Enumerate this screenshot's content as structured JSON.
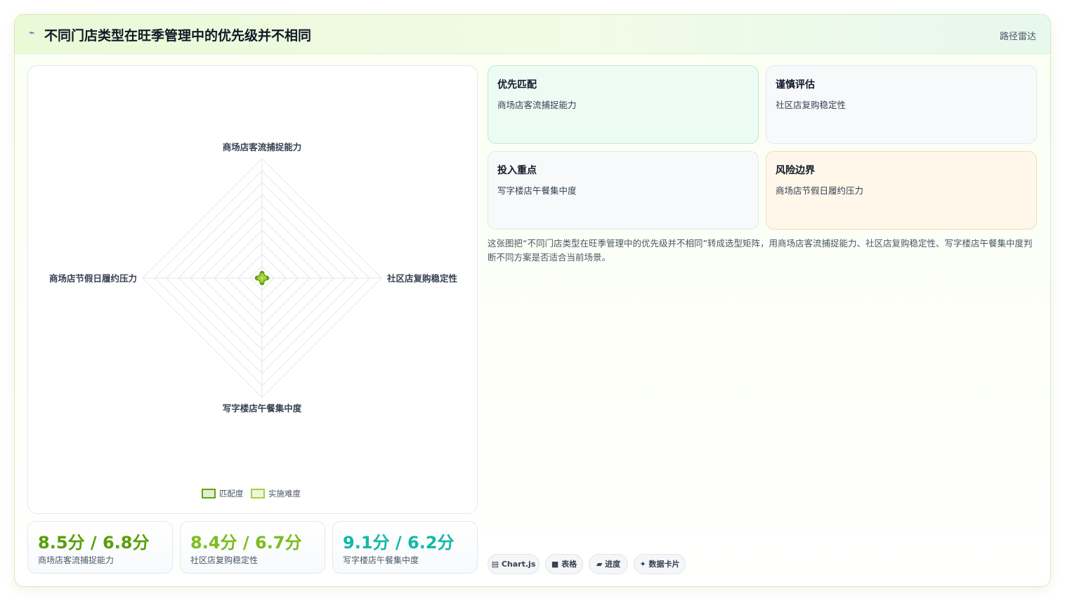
{
  "header": {
    "icon": "chart-icon",
    "title": "不同门店类型在旺季管理中的优先级并不相同",
    "tag": "路径雷达"
  },
  "chart_data": {
    "type": "radar",
    "axes": [
      "商场店客流捕捉能力",
      "社区店复购稳定性",
      "写字楼店午餐集中度",
      "商场店节假日履约压力"
    ],
    "rlim": [
      0,
      10
    ],
    "series": [
      {
        "name": "匹配度",
        "values": [
          0.4,
          0.4,
          0.4,
          0.4
        ],
        "color": "#65a30d"
      },
      {
        "name": "实施难度",
        "values": [
          0.25,
          0.25,
          0.25,
          0.25
        ],
        "color": "#a3d13c"
      }
    ],
    "grid": true,
    "legend": "bottom"
  },
  "stats": [
    {
      "value": "8.5分 / 6.8分",
      "label": "商场店客流捕捉能力",
      "color": "#5a9e0a"
    },
    {
      "value": "8.4分 / 6.7分",
      "label": "社区店复购稳定性",
      "color": "#7cbc1e"
    },
    {
      "value": "9.1分 / 6.2分",
      "label": "写字楼店午餐集中度",
      "color": "#14b8a6"
    }
  ],
  "quadrants": [
    {
      "title": "优先匹配",
      "value": "商场店客流捕捉能力"
    },
    {
      "title": "谨慎评估",
      "value": "社区店复购稳定性"
    },
    {
      "title": "投入重点",
      "value": "写字楼店午餐集中度"
    },
    {
      "title": "风险边界",
      "value": "商场店节假日履约压力"
    }
  ],
  "description": "这张图把“不同门店类型在旺季管理中的优先级并不相同”转成选型矩阵，用商场店客流捕捉能力、社区店复购稳定性、写字楼店午餐集中度判断不同方案是否适合当前场景。",
  "pills": [
    {
      "icon": "▤",
      "label": "Chart.js"
    },
    {
      "icon": "■",
      "label": "表格"
    },
    {
      "icon": "▰",
      "label": "进度"
    },
    {
      "icon": "✦",
      "label": "数据卡片"
    }
  ]
}
